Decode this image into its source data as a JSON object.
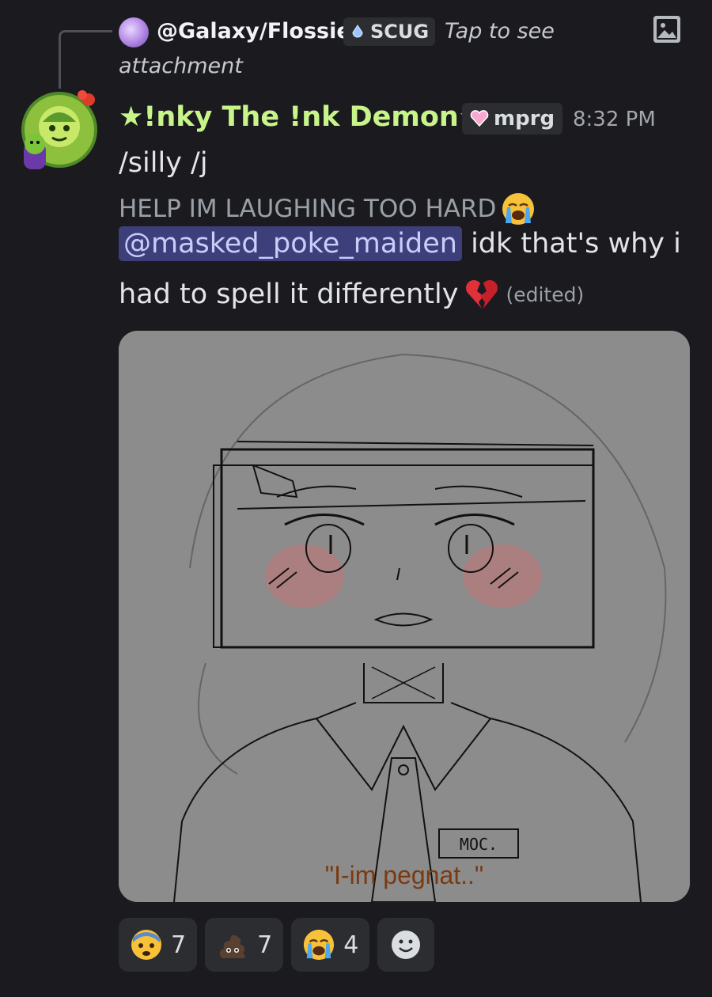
{
  "reply": {
    "username": "@Galaxy/Flossie",
    "tag": "SCUG",
    "tap_text_1": "Tap to see",
    "tap_text_2": "attachment",
    "image_icon": "image-icon"
  },
  "message": {
    "author": "★!nky The !nk Demon★",
    "role_tag": "mprg",
    "timestamp": "8:32 PM",
    "line1": "/silly /j",
    "line2": "HELP IM LAUGHING TOO HARD",
    "mention": "@masked_poke_maiden",
    "line3_after_mention": " idk that's why i",
    "line4": "had to spell it differently",
    "edited": "(edited)",
    "emojis": {
      "line2": "loudly-crying-face",
      "line4": "broken-heart"
    }
  },
  "attachment": {
    "caption": "\"I-im pegnat..\"",
    "badge_text": "MOC."
  },
  "reactions": [
    {
      "emoji": "anxious-face",
      "count": "7"
    },
    {
      "emoji": "poop-face",
      "count": "7"
    },
    {
      "emoji": "loudly-crying-face",
      "count": "4"
    }
  ],
  "colors": {
    "background": "#1b1b1f",
    "author_name": "#c8f58a",
    "mention_bg": "#3c3f7a",
    "mention_text": "#c9cdfb",
    "chip_bg": "#2b2d31"
  }
}
